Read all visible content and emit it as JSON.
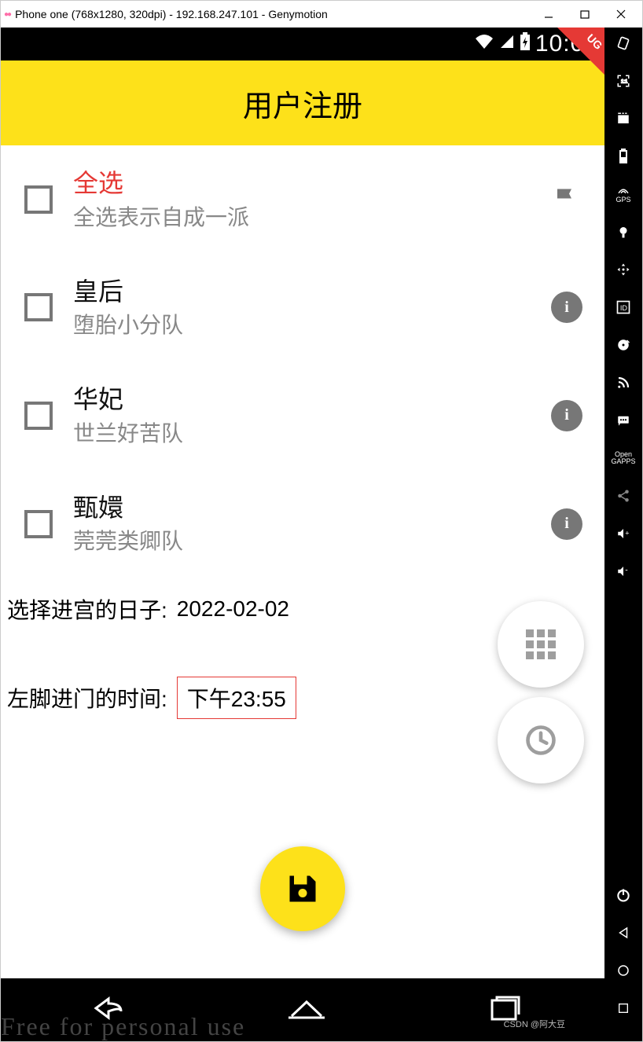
{
  "window": {
    "title": "Phone one (768x1280, 320dpi) - 192.168.247.101 - Genymotion"
  },
  "statusbar": {
    "time": "10:04"
  },
  "bug_banner": "UG",
  "appbar": {
    "title": "用户注册"
  },
  "list": [
    {
      "title": "全选",
      "subtitle": "全选表示自成一派",
      "red": true,
      "icon": "flag"
    },
    {
      "title": "皇后",
      "subtitle": "堕胎小分队",
      "red": false,
      "icon": "info"
    },
    {
      "title": "华妃",
      "subtitle": "世兰好苦队",
      "red": false,
      "icon": "info"
    },
    {
      "title": "甄嬛",
      "subtitle": "莞莞类卿队",
      "red": false,
      "icon": "info"
    }
  ],
  "date_row": {
    "label": "选择进宫的日子:",
    "value": "2022-02-02"
  },
  "time_row": {
    "label": "左脚进门的时间:",
    "value": "下午23:55"
  },
  "watermark": "Free for personal use",
  "csdn": "CSDN @阿大豆",
  "geny_tools": [
    "rotate",
    "fullscreen",
    "film",
    "battery",
    "gps",
    "camera",
    "move",
    "id",
    "disc",
    "rss",
    "sms",
    "gapps",
    "share",
    "volup",
    "voldown",
    "power"
  ],
  "geny_labels": {
    "gps": "GPS",
    "id": "ID",
    "gapps": "Open\nGAPPS"
  }
}
